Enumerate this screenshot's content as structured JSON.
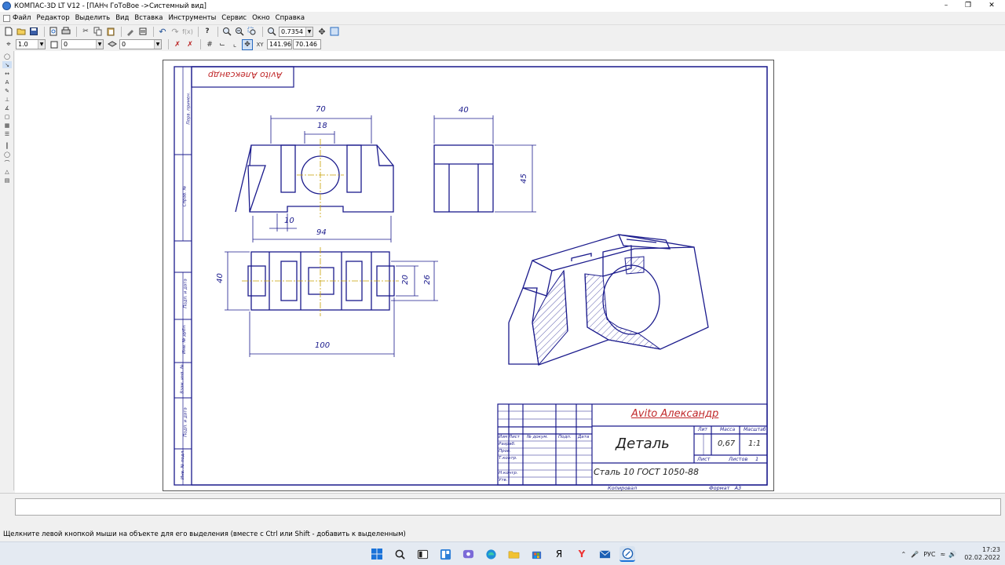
{
  "window": {
    "title": "КОМПАС-3D LT V12 - [ПАНч ГоТоВое ->Системный вид]",
    "controls": [
      "minimize-icon",
      "restore-icon",
      "close-icon"
    ]
  },
  "menu": {
    "items": [
      "Файл",
      "Редактор",
      "Выделить",
      "Вид",
      "Вставка",
      "Инструменты",
      "Сервис",
      "Окно",
      "Справка"
    ]
  },
  "toolbar1": {
    "zoom_value": "0.7354"
  },
  "toolbar2": {
    "style_value": "1.0",
    "layer_value": "0",
    "layer2_value": "0",
    "coord_x": "141.96",
    "coord_y": "70.146"
  },
  "drawing": {
    "stamp_top": "Avito  Александр",
    "side_labels": [
      "Перв. примен.",
      "Справ. №",
      "Подп. и дата",
      "Инв. № дубл.",
      "Взам. инв. №",
      "Подп. и дата",
      "Инв. № подл."
    ],
    "dims": {
      "d70": "70",
      "d18": "18",
      "d10": "10",
      "d94": "94",
      "d40_top": "40",
      "d45": "45",
      "d40_left": "40",
      "d20": "20",
      "d26": "26",
      "d100": "100"
    },
    "title_block": {
      "author": "Avito  Александр",
      "part_name": "Деталь",
      "material": "Сталь 10  ГОСТ 1050-88",
      "mass": "0,67",
      "scale": "1:1",
      "sheet_label": "Лист",
      "sheets_label": "Листов",
      "sheets_value": "1",
      "col_lit": "Лит",
      "col_mass": "Масса",
      "col_scale": "Масштаб",
      "rows": [
        "Изм Лист",
        "№ докум.",
        "Подп.",
        "Дата",
        "Разраб.",
        "Пров.",
        "Т.контр.",
        "Н.контр.",
        "Утв."
      ],
      "copied": "Копировал",
      "format": "Формат   А3"
    }
  },
  "status": {
    "hint": "Щелкните левой кнопкой мыши на объекте для его выделения (вместе с Ctrl или Shift - добавить к выделенным)"
  },
  "taskbar": {
    "lang": "РУС",
    "time": "17:23",
    "date": "02.02.2022"
  }
}
